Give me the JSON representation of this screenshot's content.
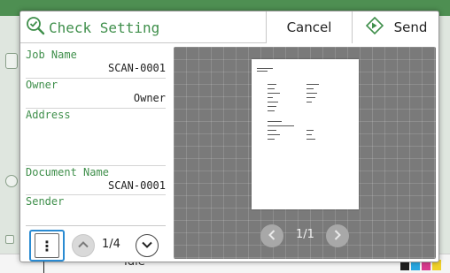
{
  "dialog": {
    "title": "Check Setting",
    "cancel_label": "Cancel",
    "send_label": "Send"
  },
  "info": {
    "job_name_label": "Job Name",
    "job_name_value": "SCAN-0001",
    "owner_label": "Owner",
    "owner_value": "Owner",
    "address_label": "Address",
    "document_name_label": "Document Name",
    "document_name_value": "SCAN-0001",
    "sender_label": "Sender"
  },
  "pager": {
    "more_label": "⋮",
    "page_count": "1/4"
  },
  "preview": {
    "page_count": "1/1"
  },
  "background": {
    "status_text": "Idle"
  },
  "colors": {
    "accent_green": "#3f8f4b",
    "focus_blue": "#2a8bd2",
    "preview_bg": "#7a7a7a"
  },
  "icons": {
    "title": "check-magnifier-icon",
    "send": "diamond-arrow-icon",
    "page_up": "chevron-up-icon",
    "page_down": "chevron-down-icon",
    "preview_prev": "chevron-left-icon",
    "preview_next": "chevron-right-icon"
  }
}
